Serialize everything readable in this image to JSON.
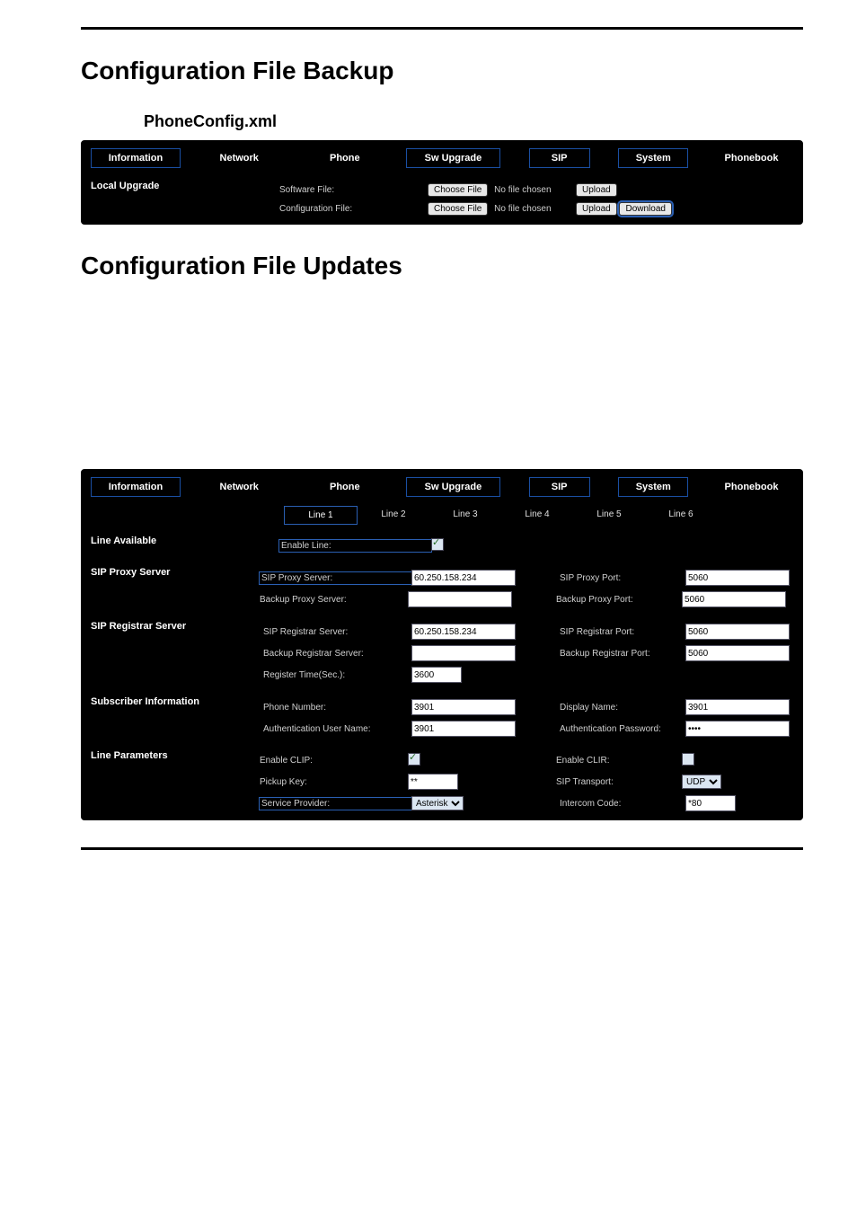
{
  "headings": {
    "backup": "Configuration File Backup",
    "phonecfg": "PhoneConfig.xml",
    "updates": "Configuration File Updates"
  },
  "tabs": {
    "information": "Information",
    "network": "Network",
    "phone": "Phone",
    "sw_upgrade": "Sw Upgrade",
    "sip": "SIP",
    "system": "System",
    "phonebook": "Phonebook"
  },
  "upgrade": {
    "side_label": "Local Upgrade",
    "software_file": "Software File:",
    "config_file": "Configuration File:",
    "choose_file": "Choose File",
    "no_file": "No file chosen",
    "upload": "Upload",
    "download": "Download"
  },
  "sip": {
    "line_tabs": [
      "Line 1",
      "Line 2",
      "Line 3",
      "Line 4",
      "Line 5",
      "Line 6"
    ],
    "sections": {
      "line_available": "Line Available",
      "sip_proxy": "SIP Proxy Server",
      "sip_registrar": "SIP Registrar Server",
      "subscriber": "Subscriber Information",
      "line_params": "Line Parameters"
    },
    "fields": {
      "enable_line": "Enable Line:",
      "sip_proxy_server": "SIP Proxy Server:",
      "sip_proxy_port": "SIP Proxy Port:",
      "backup_proxy_server": "Backup Proxy Server:",
      "backup_proxy_port": "Backup Proxy Port:",
      "sip_registrar_server": "SIP Registrar Server:",
      "sip_registrar_port": "SIP Registrar Port:",
      "backup_registrar_server": "Backup Registrar Server:",
      "backup_registrar_port": "Backup Registrar Port:",
      "register_time": "Register Time(Sec.):",
      "phone_number": "Phone Number:",
      "display_name": "Display Name:",
      "auth_user": "Authentication User Name:",
      "auth_pass": "Authentication Password:",
      "enable_clip": "Enable CLIP:",
      "enable_clir": "Enable CLIR:",
      "pickup_key": "Pickup Key:",
      "sip_transport": "SIP Transport:",
      "service_provider": "Service Provider:",
      "intercom_code": "Intercom Code:"
    },
    "values": {
      "sip_proxy_server": "60.250.158.234",
      "sip_proxy_port": "5060",
      "backup_proxy_server": "",
      "backup_proxy_port": "5060",
      "sip_registrar_server": "60.250.158.234",
      "sip_registrar_port": "5060",
      "backup_registrar_server": "",
      "backup_registrar_port": "5060",
      "register_time": "3600",
      "phone_number": "3901",
      "display_name": "3901",
      "auth_user": "3901",
      "auth_pass": "••••",
      "pickup_key": "**",
      "sip_transport": "UDP",
      "service_provider": "Asterisk",
      "intercom_code": "*80"
    }
  }
}
